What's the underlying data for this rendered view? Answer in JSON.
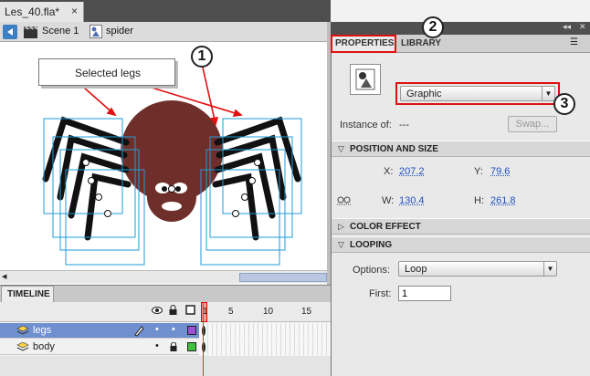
{
  "document": {
    "tab_title": "Les_40.fla*",
    "close_glyph": "×"
  },
  "breadcrumb": {
    "scene": "Scene 1",
    "symbol": "spider"
  },
  "annotation": {
    "selected_legs_label": "Selected legs",
    "callout_1": "1",
    "callout_2": "2",
    "callout_3": "3"
  },
  "timeline": {
    "tab": "TIMELINE",
    "frame_numbers": [
      "1",
      "5",
      "10",
      "15"
    ],
    "layers": [
      {
        "name": "legs",
        "color": "#9b4fd6",
        "selected": true
      },
      {
        "name": "body",
        "color": "#3ec23e",
        "selected": false
      }
    ],
    "layer_dot": "•"
  },
  "properties": {
    "tabs": [
      "PROPERTIES",
      "LIBRARY"
    ],
    "symbol_type": "Graphic",
    "instance_label": "Instance of:",
    "instance_value": "---",
    "swap_label": "Swap...",
    "sections": {
      "position_size": "POSITION AND SIZE",
      "color_effect": "COLOR EFFECT",
      "looping": "LOOPING"
    },
    "x_label": "X:",
    "x_value": "207.2",
    "y_label": "Y:",
    "y_value": "79.6",
    "w_label": "W:",
    "w_value": "130.4",
    "h_label": "H:",
    "h_value": "261.8",
    "options_label": "Options:",
    "options_value": "Loop",
    "first_label": "First:",
    "first_value": "1"
  },
  "colors": {
    "spider_body": "#6e2f2a",
    "highlight": "#e01010",
    "selection": "#1e9bd7"
  }
}
